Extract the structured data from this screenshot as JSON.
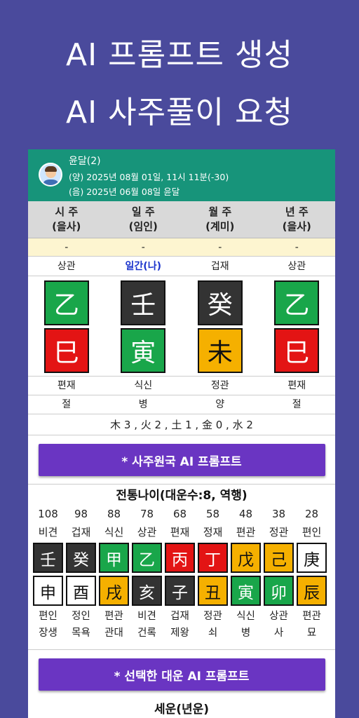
{
  "headline": {
    "line1": "AI 프롬프트 생성",
    "line2": "AI 사주풀이 요청"
  },
  "profile": {
    "name": "윤달(2)",
    "solar": "(양) 2025년 08월 01일, 11시 11분(-30)",
    "lunar": "(음) 2025년 06월 08일  윤달",
    "avatar_icon": "user-avatar-icon"
  },
  "pillars": [
    {
      "title": "시 주",
      "sub": "(을사)",
      "dash": "-",
      "top_god": "상관",
      "stem": "乙",
      "stem_color": "#19a64a",
      "branch": "巳",
      "branch_color": "#e31414",
      "bottom_god": "편재",
      "stage": "절"
    },
    {
      "title": "일 주",
      "sub": "(임인)",
      "dash": "-",
      "top_god": "일간(나)",
      "stem": "壬",
      "stem_color": "#333333",
      "branch": "寅",
      "branch_color": "#19a64a",
      "bottom_god": "식신",
      "stage": "병"
    },
    {
      "title": "월 주",
      "sub": "(계미)",
      "dash": "-",
      "top_god": "겁재",
      "stem": "癸",
      "stem_color": "#333333",
      "branch": "未",
      "branch_color": "#f5b000",
      "bottom_god": "정관",
      "stage": "양"
    },
    {
      "title": "년 주",
      "sub": "(을사)",
      "dash": "-",
      "top_god": "상관",
      "stem": "乙",
      "stem_color": "#19a64a",
      "branch": "巳",
      "branch_color": "#e31414",
      "bottom_god": "편재",
      "stage": "절"
    }
  ],
  "elements": "木 3 , 火 2 , 土 1 , 金 0 , 水 2",
  "buttons": {
    "saju_prompt": "* 사주원국 AI 프롬프트",
    "daewoon_prompt": "* 선택한 대운 AI 프롬프트"
  },
  "daewoon_title": "전통나이(대운수:8, 역행)",
  "daewoon": [
    {
      "age": "108",
      "top_god": "비견",
      "stem": "壬",
      "stem_color": "#333333",
      "branch": "申",
      "branch_color": "#ffffff",
      "bottom_god": "편인",
      "stage": "장생"
    },
    {
      "age": "98",
      "top_god": "겁재",
      "stem": "癸",
      "stem_color": "#333333",
      "branch": "酉",
      "branch_color": "#ffffff",
      "bottom_god": "정인",
      "stage": "목욕"
    },
    {
      "age": "88",
      "top_god": "식신",
      "stem": "甲",
      "stem_color": "#19a64a",
      "branch": "戌",
      "branch_color": "#f5b000",
      "bottom_god": "편관",
      "stage": "관대"
    },
    {
      "age": "78",
      "top_god": "상관",
      "stem": "乙",
      "stem_color": "#19a64a",
      "branch": "亥",
      "branch_color": "#333333",
      "bottom_god": "비견",
      "stage": "건록"
    },
    {
      "age": "68",
      "top_god": "편재",
      "stem": "丙",
      "stem_color": "#e31414",
      "branch": "子",
      "branch_color": "#333333",
      "bottom_god": "겁재",
      "stage": "제왕"
    },
    {
      "age": "58",
      "top_god": "정재",
      "stem": "丁",
      "stem_color": "#e31414",
      "branch": "丑",
      "branch_color": "#f5b000",
      "bottom_god": "정관",
      "stage": "쇠"
    },
    {
      "age": "48",
      "top_god": "편관",
      "stem": "戊",
      "stem_color": "#f5b000",
      "branch": "寅",
      "branch_color": "#19a64a",
      "bottom_god": "식신",
      "stage": "병"
    },
    {
      "age": "38",
      "top_god": "정관",
      "stem": "己",
      "stem_color": "#f5b000",
      "branch": "卯",
      "branch_color": "#19a64a",
      "bottom_god": "상관",
      "stage": "사"
    },
    {
      "age": "28",
      "top_god": "편인",
      "stem": "庚",
      "stem_color": "#ffffff",
      "branch": "辰",
      "branch_color": "#f5b000",
      "bottom_god": "편관",
      "stage": "묘"
    }
  ],
  "saewoon_title": "세운(년운)"
}
